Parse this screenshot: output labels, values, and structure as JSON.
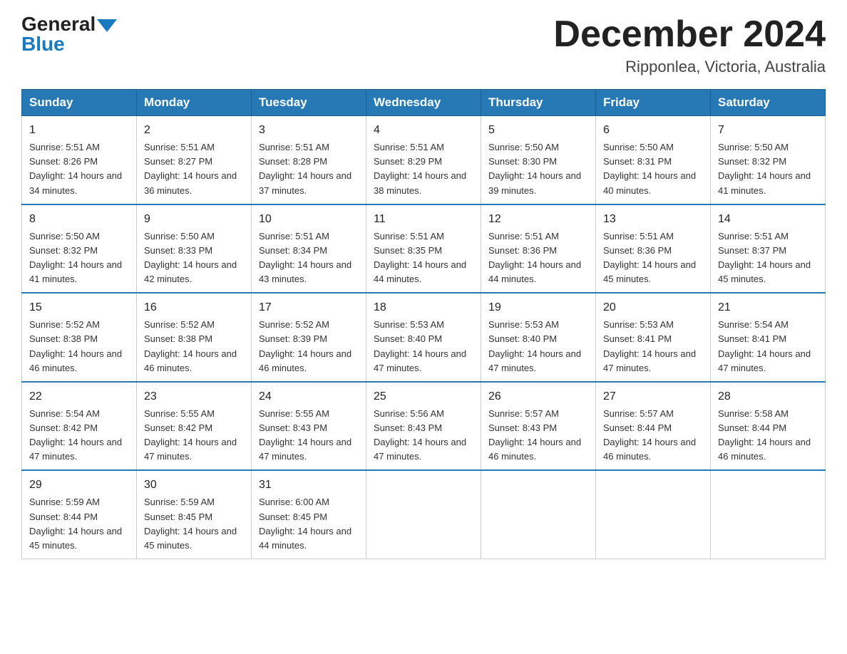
{
  "header": {
    "logo_general": "General",
    "logo_blue": "Blue",
    "month_title": "December 2024",
    "location": "Ripponlea, Victoria, Australia"
  },
  "weekdays": [
    "Sunday",
    "Monday",
    "Tuesday",
    "Wednesday",
    "Thursday",
    "Friday",
    "Saturday"
  ],
  "weeks": [
    [
      {
        "day": "1",
        "sunrise": "Sunrise: 5:51 AM",
        "sunset": "Sunset: 8:26 PM",
        "daylight": "Daylight: 14 hours and 34 minutes."
      },
      {
        "day": "2",
        "sunrise": "Sunrise: 5:51 AM",
        "sunset": "Sunset: 8:27 PM",
        "daylight": "Daylight: 14 hours and 36 minutes."
      },
      {
        "day": "3",
        "sunrise": "Sunrise: 5:51 AM",
        "sunset": "Sunset: 8:28 PM",
        "daylight": "Daylight: 14 hours and 37 minutes."
      },
      {
        "day": "4",
        "sunrise": "Sunrise: 5:51 AM",
        "sunset": "Sunset: 8:29 PM",
        "daylight": "Daylight: 14 hours and 38 minutes."
      },
      {
        "day": "5",
        "sunrise": "Sunrise: 5:50 AM",
        "sunset": "Sunset: 8:30 PM",
        "daylight": "Daylight: 14 hours and 39 minutes."
      },
      {
        "day": "6",
        "sunrise": "Sunrise: 5:50 AM",
        "sunset": "Sunset: 8:31 PM",
        "daylight": "Daylight: 14 hours and 40 minutes."
      },
      {
        "day": "7",
        "sunrise": "Sunrise: 5:50 AM",
        "sunset": "Sunset: 8:32 PM",
        "daylight": "Daylight: 14 hours and 41 minutes."
      }
    ],
    [
      {
        "day": "8",
        "sunrise": "Sunrise: 5:50 AM",
        "sunset": "Sunset: 8:32 PM",
        "daylight": "Daylight: 14 hours and 41 minutes."
      },
      {
        "day": "9",
        "sunrise": "Sunrise: 5:50 AM",
        "sunset": "Sunset: 8:33 PM",
        "daylight": "Daylight: 14 hours and 42 minutes."
      },
      {
        "day": "10",
        "sunrise": "Sunrise: 5:51 AM",
        "sunset": "Sunset: 8:34 PM",
        "daylight": "Daylight: 14 hours and 43 minutes."
      },
      {
        "day": "11",
        "sunrise": "Sunrise: 5:51 AM",
        "sunset": "Sunset: 8:35 PM",
        "daylight": "Daylight: 14 hours and 44 minutes."
      },
      {
        "day": "12",
        "sunrise": "Sunrise: 5:51 AM",
        "sunset": "Sunset: 8:36 PM",
        "daylight": "Daylight: 14 hours and 44 minutes."
      },
      {
        "day": "13",
        "sunrise": "Sunrise: 5:51 AM",
        "sunset": "Sunset: 8:36 PM",
        "daylight": "Daylight: 14 hours and 45 minutes."
      },
      {
        "day": "14",
        "sunrise": "Sunrise: 5:51 AM",
        "sunset": "Sunset: 8:37 PM",
        "daylight": "Daylight: 14 hours and 45 minutes."
      }
    ],
    [
      {
        "day": "15",
        "sunrise": "Sunrise: 5:52 AM",
        "sunset": "Sunset: 8:38 PM",
        "daylight": "Daylight: 14 hours and 46 minutes."
      },
      {
        "day": "16",
        "sunrise": "Sunrise: 5:52 AM",
        "sunset": "Sunset: 8:38 PM",
        "daylight": "Daylight: 14 hours and 46 minutes."
      },
      {
        "day": "17",
        "sunrise": "Sunrise: 5:52 AM",
        "sunset": "Sunset: 8:39 PM",
        "daylight": "Daylight: 14 hours and 46 minutes."
      },
      {
        "day": "18",
        "sunrise": "Sunrise: 5:53 AM",
        "sunset": "Sunset: 8:40 PM",
        "daylight": "Daylight: 14 hours and 47 minutes."
      },
      {
        "day": "19",
        "sunrise": "Sunrise: 5:53 AM",
        "sunset": "Sunset: 8:40 PM",
        "daylight": "Daylight: 14 hours and 47 minutes."
      },
      {
        "day": "20",
        "sunrise": "Sunrise: 5:53 AM",
        "sunset": "Sunset: 8:41 PM",
        "daylight": "Daylight: 14 hours and 47 minutes."
      },
      {
        "day": "21",
        "sunrise": "Sunrise: 5:54 AM",
        "sunset": "Sunset: 8:41 PM",
        "daylight": "Daylight: 14 hours and 47 minutes."
      }
    ],
    [
      {
        "day": "22",
        "sunrise": "Sunrise: 5:54 AM",
        "sunset": "Sunset: 8:42 PM",
        "daylight": "Daylight: 14 hours and 47 minutes."
      },
      {
        "day": "23",
        "sunrise": "Sunrise: 5:55 AM",
        "sunset": "Sunset: 8:42 PM",
        "daylight": "Daylight: 14 hours and 47 minutes."
      },
      {
        "day": "24",
        "sunrise": "Sunrise: 5:55 AM",
        "sunset": "Sunset: 8:43 PM",
        "daylight": "Daylight: 14 hours and 47 minutes."
      },
      {
        "day": "25",
        "sunrise": "Sunrise: 5:56 AM",
        "sunset": "Sunset: 8:43 PM",
        "daylight": "Daylight: 14 hours and 47 minutes."
      },
      {
        "day": "26",
        "sunrise": "Sunrise: 5:57 AM",
        "sunset": "Sunset: 8:43 PM",
        "daylight": "Daylight: 14 hours and 46 minutes."
      },
      {
        "day": "27",
        "sunrise": "Sunrise: 5:57 AM",
        "sunset": "Sunset: 8:44 PM",
        "daylight": "Daylight: 14 hours and 46 minutes."
      },
      {
        "day": "28",
        "sunrise": "Sunrise: 5:58 AM",
        "sunset": "Sunset: 8:44 PM",
        "daylight": "Daylight: 14 hours and 46 minutes."
      }
    ],
    [
      {
        "day": "29",
        "sunrise": "Sunrise: 5:59 AM",
        "sunset": "Sunset: 8:44 PM",
        "daylight": "Daylight: 14 hours and 45 minutes."
      },
      {
        "day": "30",
        "sunrise": "Sunrise: 5:59 AM",
        "sunset": "Sunset: 8:45 PM",
        "daylight": "Daylight: 14 hours and 45 minutes."
      },
      {
        "day": "31",
        "sunrise": "Sunrise: 6:00 AM",
        "sunset": "Sunset: 8:45 PM",
        "daylight": "Daylight: 14 hours and 44 minutes."
      },
      null,
      null,
      null,
      null
    ]
  ]
}
